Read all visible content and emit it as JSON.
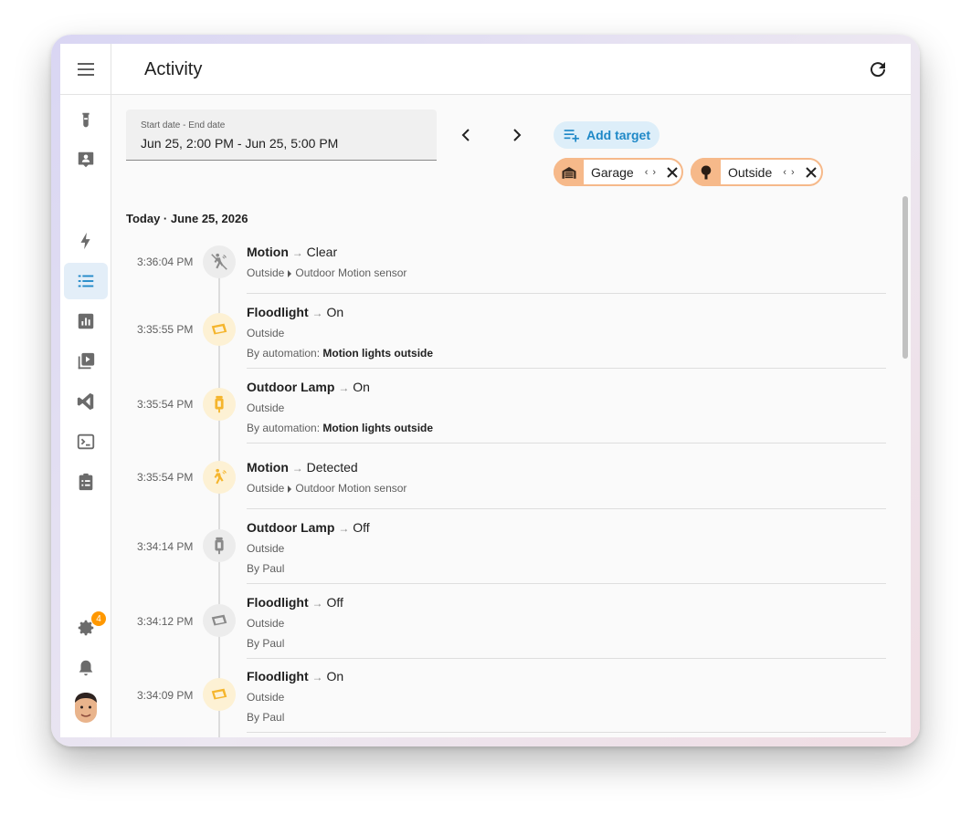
{
  "header": {
    "title": "Activity"
  },
  "date_range": {
    "label": "Start date - End date",
    "value": "Jun 25, 2:00 PM - Jun 25, 5:00 PM"
  },
  "targets": {
    "add_label": "Add target",
    "chips": [
      {
        "label": "Garage",
        "icon": "garage-icon"
      },
      {
        "label": "Outside",
        "icon": "tree-icon"
      }
    ]
  },
  "sidebar": {
    "items": [
      {
        "name": "test-tube-icon"
      },
      {
        "name": "account-box-icon"
      },
      {
        "name": "lightning-icon"
      },
      {
        "name": "activity-list-icon",
        "active": true
      },
      {
        "name": "chart-box-icon"
      },
      {
        "name": "media-icon"
      },
      {
        "name": "vscode-icon"
      },
      {
        "name": "terminal-icon"
      },
      {
        "name": "clipboard-list-icon"
      }
    ],
    "settings_badge": "4"
  },
  "day_heading": "Today · June 25, 2026",
  "entries": [
    {
      "time": "3:36:04 PM",
      "name": "Motion",
      "state": "Clear",
      "area": "Outside",
      "device": "Outdoor Motion sensor",
      "by_prefix": "",
      "by": "",
      "icon": "motion-sensor-off-icon",
      "tone": "grey"
    },
    {
      "time": "3:35:55 PM",
      "name": "Floodlight",
      "state": "On",
      "area": "Outside",
      "device": "",
      "by_prefix": "By automation:",
      "by": "Motion lights outside",
      "icon": "floodlight-icon",
      "tone": "amber"
    },
    {
      "time": "3:35:54 PM",
      "name": "Outdoor Lamp",
      "state": "On",
      "area": "Outside",
      "device": "",
      "by_prefix": "By automation:",
      "by": "Motion lights outside",
      "icon": "outdoor-lamp-icon",
      "tone": "amber"
    },
    {
      "time": "3:35:54 PM",
      "name": "Motion",
      "state": "Detected",
      "area": "Outside",
      "device": "Outdoor Motion sensor",
      "by_prefix": "",
      "by": "",
      "icon": "motion-sensor-icon",
      "tone": "amber"
    },
    {
      "time": "3:34:14 PM",
      "name": "Outdoor Lamp",
      "state": "Off",
      "area": "Outside",
      "device": "",
      "by_prefix": "By Paul",
      "by": "",
      "icon": "outdoor-lamp-icon",
      "tone": "grey"
    },
    {
      "time": "3:34:12 PM",
      "name": "Floodlight",
      "state": "Off",
      "area": "Outside",
      "device": "",
      "by_prefix": "By Paul",
      "by": "",
      "icon": "floodlight-icon",
      "tone": "grey"
    },
    {
      "time": "3:34:09 PM",
      "name": "Floodlight",
      "state": "On",
      "area": "Outside",
      "device": "",
      "by_prefix": "By Paul",
      "by": "",
      "icon": "floodlight-icon",
      "tone": "amber"
    }
  ],
  "colors": {
    "accent": "#1e88c7",
    "chip": "#f6b98a",
    "amber_icon": "#f5b52c",
    "grey_icon": "#8a8a8a"
  }
}
